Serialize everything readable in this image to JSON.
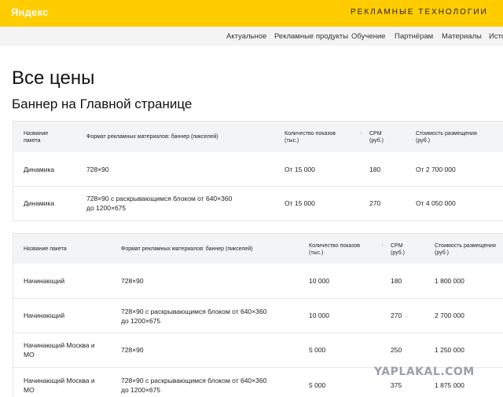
{
  "header": {
    "logo": "Яндекс",
    "subtitle": "РЕКЛАМНЫЕ ТЕХНОЛОГИИ"
  },
  "nav": [
    "Актуальное",
    "Рекламные продукты",
    "Обучение",
    "Партнёрам",
    "Материалы",
    "Исто"
  ],
  "page": {
    "title": "Все цены",
    "section_title": "Баннер на Главной странице"
  },
  "table1": {
    "headers": {
      "package": [
        "Название",
        "пакета"
      ],
      "format": "Формат рекламных материалов: баннер (пикселей)",
      "impressions": [
        "Количество показов",
        "(тыс.)"
      ],
      "cpm": [
        "CPM",
        "(руб.)"
      ],
      "cost": [
        "Стоимость размещения",
        "(руб.)"
      ]
    },
    "rows": [
      {
        "package": [
          "Динамика"
        ],
        "format": [
          "728×90"
        ],
        "impressions": "От 15 000",
        "cpm": "180",
        "cost": "От 2 700 000"
      },
      {
        "package": [
          "Динамика"
        ],
        "format": [
          "728×90 с раскрывающимся блоком от 640×360",
          "до 1200×675"
        ],
        "impressions": "От 15 000",
        "cpm": "270",
        "cost": "От 4 050 000"
      }
    ]
  },
  "table2": {
    "headers": {
      "package": "Название пакета",
      "format": "Формат рекламных материалов: баннер (пикселей)",
      "impressions": [
        "Количество показов",
        "(тыс.)"
      ],
      "cpm": [
        "CPM",
        "(руб.)"
      ],
      "cost": [
        "Стоимость размещения",
        "(руб.)"
      ]
    },
    "rows": [
      {
        "package": [
          "Начинающий"
        ],
        "format": [
          "728×90"
        ],
        "impressions": "10 000",
        "cpm": "180",
        "cost": "1 800 000"
      },
      {
        "package": [
          "Начинающий"
        ],
        "format": [
          "728×90 с раскрывающимся блоком от 640×360",
          "до 1200×675"
        ],
        "impressions": "10 000",
        "cpm": "270",
        "cost": "2 700 000"
      },
      {
        "package": [
          "Начинающий Москва и",
          "МО"
        ],
        "format": [
          "728×90"
        ],
        "impressions": "5 000",
        "cpm": "250",
        "cost": "1 250 000"
      },
      {
        "package": [
          "Начинающий Москва и",
          "МО"
        ],
        "format": [
          "728×90 с раскрывающимся блоком от 640×360",
          "до 1200×675"
        ],
        "impressions": "5 000",
        "cpm": "375",
        "cost": "1 875 000"
      }
    ]
  },
  "watermark": "YAPLAKAL.COM"
}
